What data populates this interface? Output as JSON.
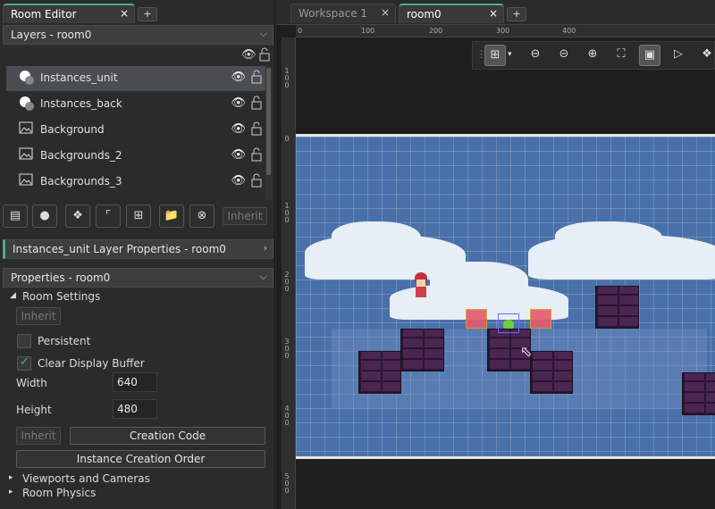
{
  "left_tab": {
    "title": "Room Editor",
    "close": "×",
    "plus": "+"
  },
  "layers_panel": {
    "title": "Layers - room0",
    "items": [
      {
        "label": "Instances_unit",
        "type": "instance",
        "selected": true
      },
      {
        "label": "Instances_back",
        "type": "instance",
        "selected": false
      },
      {
        "label": "Background",
        "type": "background",
        "selected": false
      },
      {
        "label": "Backgrounds_2",
        "type": "background",
        "selected": false
      },
      {
        "label": "Backgrounds_3",
        "type": "background",
        "selected": false
      }
    ],
    "inherit_label": "Inherit"
  },
  "layer_props": {
    "title": "Instances_unit Layer Properties - room0"
  },
  "properties": {
    "title": "Properties - room0",
    "room_settings": "Room Settings",
    "inherit": "Inherit",
    "persistent_label": "Persistent",
    "persistent": false,
    "clear_display_label": "Clear Display Buffer",
    "clear_display": true,
    "width_label": "Width",
    "width": "640",
    "height_label": "Height",
    "height": "480",
    "inherit2": "Inherit",
    "creation_code": "Creation Code",
    "instance_order": "Instance Creation Order",
    "viewports": "Viewports and Cameras",
    "physics": "Room Physics"
  },
  "workspace_tabs": [
    {
      "label": "Workspace 1",
      "active": false
    },
    {
      "label": "room0",
      "active": true
    }
  ],
  "ruler": {
    "h_ticks": [
      "0",
      "100",
      "200",
      "300",
      "400"
    ],
    "v_ticks": [
      "1 0 0",
      "0",
      "1 0 0",
      "2 0 0",
      "3 0 0",
      "4 0 0",
      "5 0 0"
    ]
  },
  "colors": {
    "accent": "#4caf8a",
    "room_bg": "#4970a8",
    "selected_layer": "#4a4d52"
  }
}
